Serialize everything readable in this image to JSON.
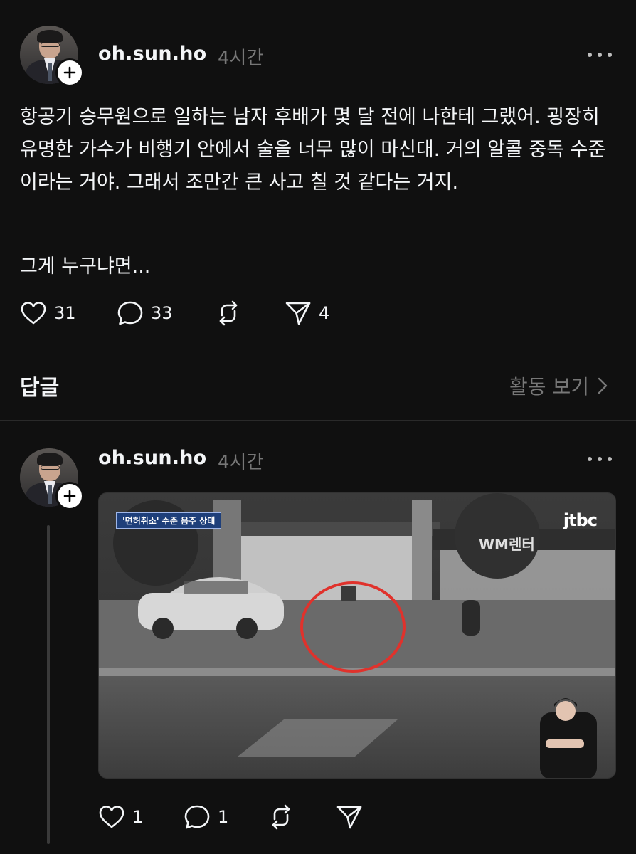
{
  "posts": [
    {
      "username": "oh.sun.ho",
      "time": "4시간",
      "paragraphs": [
        "항공기 승무원으로 일하는 남자 후배가 몇 달 전에 나한테 그랬어. 굉장히 유명한 가수가 비행기 안에서 술을 너무 많이 마신대. 거의 알콜 중독 수준이라는 거야. 그래서 조만간 큰 사고 칠 것 같다는 거지.",
        "그게 누구냐면..."
      ],
      "likes": "31",
      "comments": "33",
      "shares": "4"
    },
    {
      "username": "oh.sun.ho",
      "time": "4시간",
      "video": {
        "caption": "'면허취소' 수준 음주 상태",
        "logo": "jtbc",
        "store_sign": "WM렌터"
      },
      "likes": "1",
      "comments": "1"
    }
  ],
  "replies_section": {
    "title": "답글",
    "activity_link": "활동 보기"
  },
  "icons": {
    "like": "heart-icon",
    "comment": "speech-bubble-icon",
    "repost": "repost-arrows-icon",
    "share": "paper-plane-icon",
    "more": "more-horizontal-icon",
    "follow": "plus-icon",
    "chevron": "chevron-right-icon"
  },
  "colors": {
    "background": "#101010",
    "text": "#f3f5f7",
    "muted": "#777777"
  }
}
